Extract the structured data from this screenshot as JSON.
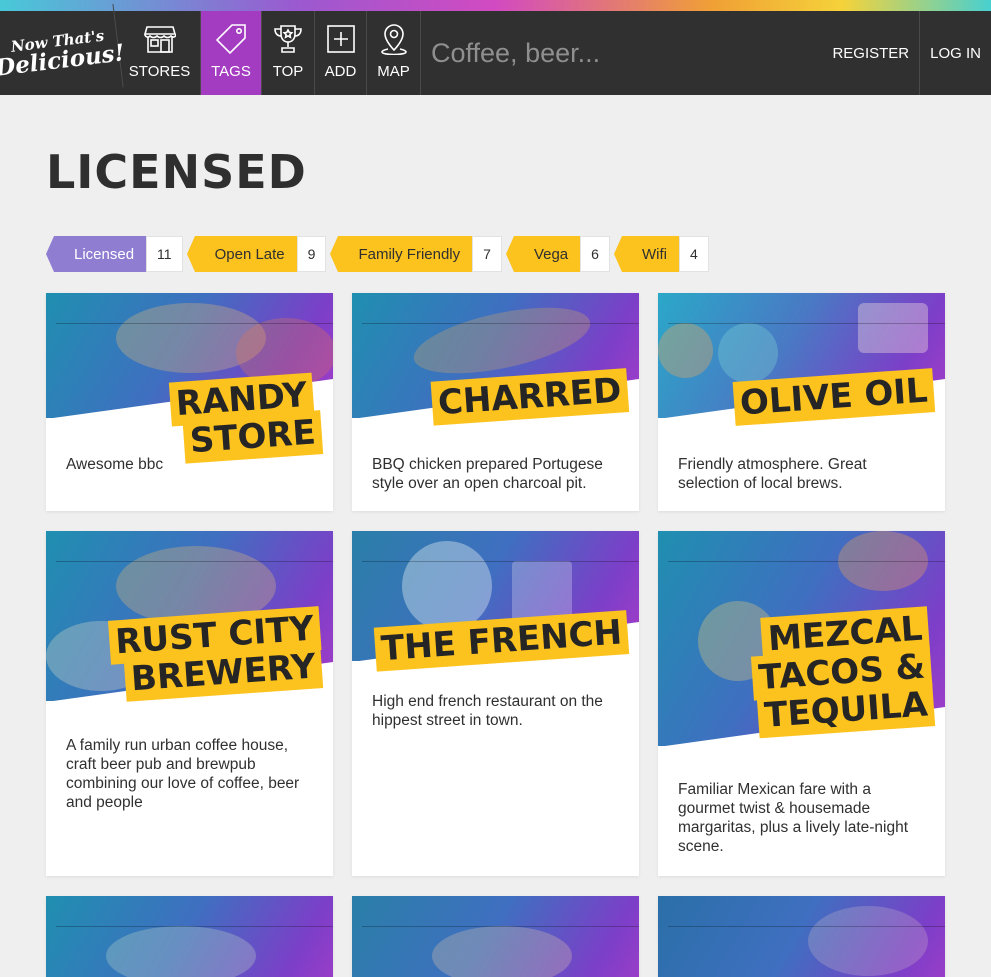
{
  "logo": {
    "line1": "Now That's",
    "line2": "Delicious!"
  },
  "nav": {
    "stores": "STORES",
    "tags": "TAGS",
    "top": "TOP",
    "add": "ADD",
    "map": "MAP"
  },
  "search": {
    "placeholder": "Coffee, beer..."
  },
  "auth": {
    "register": "REGISTER",
    "login": "LOG IN"
  },
  "page_title": "LICENSED",
  "tags": [
    {
      "label": "Licensed",
      "count": "11",
      "active": true
    },
    {
      "label": "Open Late",
      "count": "9"
    },
    {
      "label": "Family Friendly",
      "count": "7"
    },
    {
      "label": "Vega",
      "count": "6"
    },
    {
      "label": "Wifi",
      "count": "4"
    }
  ],
  "stores": [
    {
      "name": "Randy Store",
      "description": "Awesome bbc"
    },
    {
      "name": "Charred",
      "description": "BBQ chicken prepared Portugese style over an open charcoal pit."
    },
    {
      "name": "Olive Oil",
      "description": "Friendly atmosphere. Great selection of local brews."
    },
    {
      "name": "Rust City Brewery",
      "description": "A family run urban coffee house, craft beer pub and brewpub combining our love of coffee, beer and people"
    },
    {
      "name": "The French",
      "description": "High end french restaurant on the hippest street in town."
    },
    {
      "name": "Mezcal Tacos & Tequila",
      "description": "Familiar Mexican fare with a gourmet twist & housemade margaritas, plus a lively late-night scene."
    }
  ],
  "colors": {
    "nav_bg": "#303030",
    "active_tab": "#a43cc2",
    "tag_yellow": "#fcc21d",
    "tag_active": "#8f7dd2",
    "page_bg": "#efefef"
  }
}
